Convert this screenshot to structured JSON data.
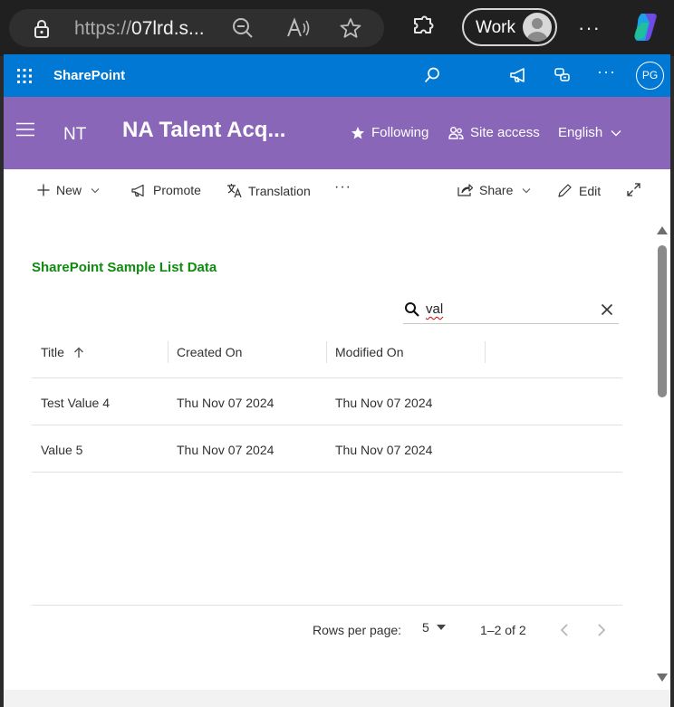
{
  "browser": {
    "url_prefix": "https://",
    "url_host": "07lrd.s...",
    "profile_label": "Work",
    "more_label": "···",
    "icons": [
      "lock-icon",
      "zoom-out-icon",
      "read-aloud-icon",
      "favorite-star-icon",
      "extensions-icon",
      "copilot-icon"
    ]
  },
  "suite_bar": {
    "app_title": "SharePoint",
    "more_label": "···",
    "avatar_initials": "PG",
    "icons": [
      "app-launcher-icon",
      "search-icon",
      "feedback-megaphone-icon",
      "help-icon"
    ],
    "color": "#0078d4"
  },
  "site_header": {
    "abbr": "NT",
    "name": "NA Talent Acq...",
    "following_label": "Following",
    "site_access_label": "Site access",
    "language_label": "English",
    "color": "#8a66b8"
  },
  "command_bar": {
    "new_label": "New",
    "promote_label": "Promote",
    "translation_label": "Translation",
    "more_label": "···",
    "share_label": "Share",
    "edit_label": "Edit"
  },
  "list": {
    "title": "SharePoint Sample List Data",
    "title_color": "#108a10",
    "search_value": "val",
    "columns": [
      "Title",
      "Created On",
      "Modified On"
    ],
    "sort_column": "Title",
    "sort_direction": "ascending",
    "rows": [
      {
        "title": "Test Value 4",
        "created": "Thu Nov 07 2024",
        "modified": "Thu Nov 07 2024"
      },
      {
        "title": "Value 5",
        "created": "Thu Nov 07 2024",
        "modified": "Thu Nov 07 2024"
      }
    ],
    "pagination": {
      "rows_per_page_label": "Rows per page:",
      "rows_per_page_value": "5",
      "range_label": "1–2 of 2"
    }
  }
}
